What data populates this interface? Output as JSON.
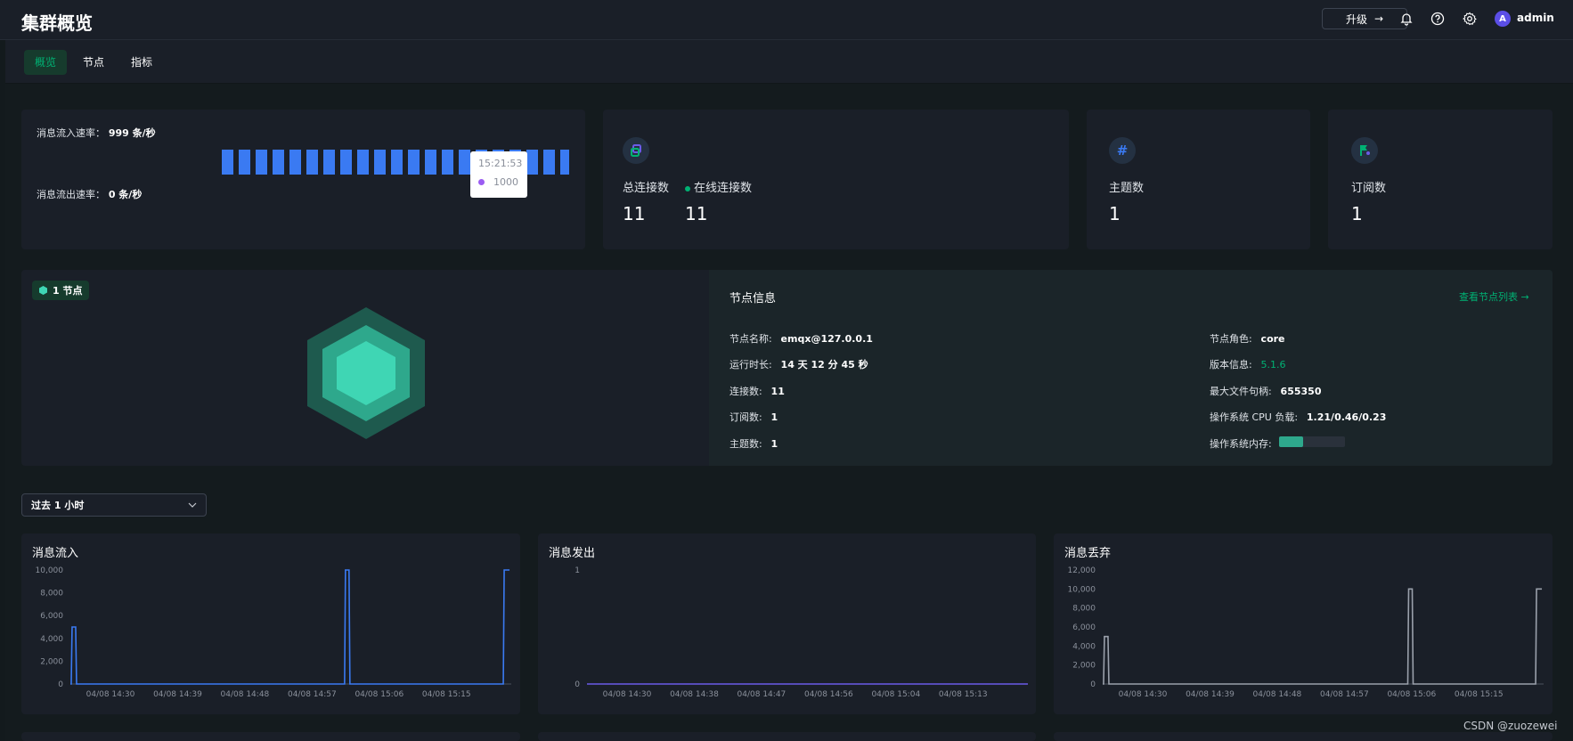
{
  "header": {
    "title": "集群概览",
    "upgrade_label": "升级",
    "user_initial": "A",
    "username": "admin",
    "icons": [
      "bell-icon",
      "help-icon",
      "gear-icon"
    ]
  },
  "tabs": [
    {
      "label": "概览",
      "active": true
    },
    {
      "label": "节点",
      "active": false
    },
    {
      "label": "指标",
      "active": false
    }
  ],
  "rates": {
    "in_label": "消息流入速率：",
    "in_value": "999 条/秒",
    "out_label": "消息流出速率：",
    "out_value": "0 条/秒",
    "sparkline_bars": 21,
    "tooltip": {
      "time": "15:21:53",
      "value": "1000"
    }
  },
  "stats": {
    "total_conn_label": "总连接数",
    "total_conn_value": "11",
    "online_conn_label": "在线连接数",
    "online_conn_value": "11",
    "topics_label": "主题数",
    "topics_value": "1",
    "subs_label": "订阅数",
    "subs_value": "1"
  },
  "node": {
    "badge": "1 节点",
    "title": "节点信息",
    "link": "查看节点列表",
    "fields_left": [
      {
        "label": "节点名称:",
        "value": "emqx@127.0.0.1"
      },
      {
        "label": "运行时长:",
        "value": "14 天 12 分 45 秒"
      },
      {
        "label": "连接数:",
        "value": "11"
      },
      {
        "label": "订阅数:",
        "value": "1"
      },
      {
        "label": "主题数:",
        "value": "1"
      }
    ],
    "fields_right": [
      {
        "label": "节点角色:",
        "value": "core"
      },
      {
        "label": "版本信息:",
        "value": "5.1.6"
      },
      {
        "label": "最大文件句柄:",
        "value": "655350"
      },
      {
        "label": "操作系统 CPU 负载:",
        "value": "1.21/0.46/0.23"
      },
      {
        "label": "操作系统内存:",
        "value": ""
      }
    ],
    "memory_usage": 0.36,
    "colors": {
      "accent": "#00b173",
      "hex_outer": "#1e5a4e",
      "hex_mid": "#2ea88c",
      "hex_inner": "#3fd6b4"
    }
  },
  "time_range": {
    "selected": "过去 1 小时"
  },
  "charts": {
    "in_title": "消息流入",
    "out_title": "消息发出",
    "drop_title": "消息丢弃"
  },
  "chart_data": [
    {
      "type": "line",
      "title": "消息流入",
      "x": [
        "04/08 14:30",
        "04/08 14:39",
        "04/08 14:48",
        "04/08 14:57",
        "04/08 15:06",
        "04/08 15:15"
      ],
      "ylim": [
        0,
        10000
      ],
      "yticks": [
        "0",
        "2,000",
        "4,000",
        "6,000",
        "8,000",
        "10,000"
      ],
      "series": [
        {
          "color": "#3a7af2",
          "peaks": [
            [
              0.01,
              5000
            ],
            [
              0.63,
              10000
            ],
            [
              0.99,
              10000
            ]
          ]
        }
      ]
    },
    {
      "type": "line",
      "title": "消息发出",
      "x": [
        "04/08 14:30",
        "04/08 14:38",
        "04/08 14:47",
        "04/08 14:56",
        "04/08 15:04",
        "04/08 15:13"
      ],
      "ylim": [
        0,
        1
      ],
      "yticks": [
        "0",
        "1"
      ],
      "series": [
        {
          "color": "#6b5ce7",
          "peaks": []
        }
      ]
    },
    {
      "type": "line",
      "title": "消息丢弃",
      "x": [
        "04/08 14:30",
        "04/08 14:39",
        "04/08 14:48",
        "04/08 14:57",
        "04/08 15:06",
        "04/08 15:15"
      ],
      "ylim": [
        0,
        12000
      ],
      "yticks": [
        "0",
        "2,000",
        "4,000",
        "6,000",
        "8,000",
        "10,000",
        "12,000"
      ],
      "series": [
        {
          "color": "#9aa0ab",
          "peaks": [
            [
              0.01,
              5000
            ],
            [
              0.7,
              10000
            ],
            [
              0.99,
              10000
            ]
          ]
        }
      ]
    }
  ],
  "watermark": "CSDN @zuozewei"
}
